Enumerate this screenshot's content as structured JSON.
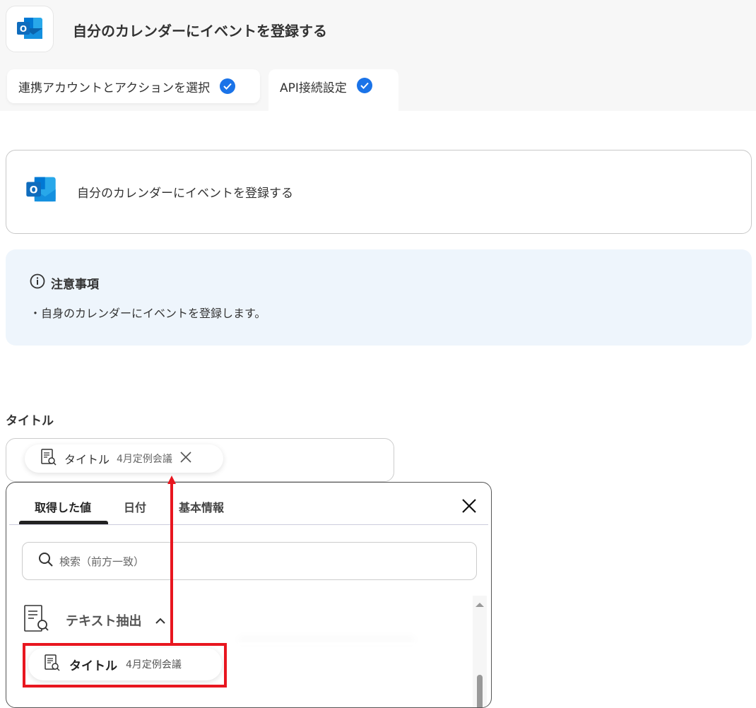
{
  "header": {
    "title": "自分のカレンダーにイベントを登録する",
    "app_icon": "outlook-icon"
  },
  "steps": [
    {
      "label": "連携アカウントとアクションを選択",
      "done": true
    },
    {
      "label": "API接続設定",
      "done": true
    }
  ],
  "action_card": {
    "label": "自分のカレンダーにイベントを登録する"
  },
  "notice": {
    "title": "注意事項",
    "body": "・自身のカレンダーにイベントを登録します。"
  },
  "field": {
    "label": "タイトル",
    "chip": {
      "name": "タイトル",
      "value": "4月定例会議"
    }
  },
  "picker": {
    "tabs": [
      "取得した値",
      "日付",
      "基本情報"
    ],
    "active_tab": 0,
    "search_placeholder": "検索（前方一致）",
    "section": "テキスト抽出",
    "item": {
      "name": "タイトル",
      "value": "4月定例会議"
    }
  },
  "colors": {
    "accent": "#1a73e8",
    "highlight": "#e8161f",
    "notice_bg": "#eef5fc"
  }
}
